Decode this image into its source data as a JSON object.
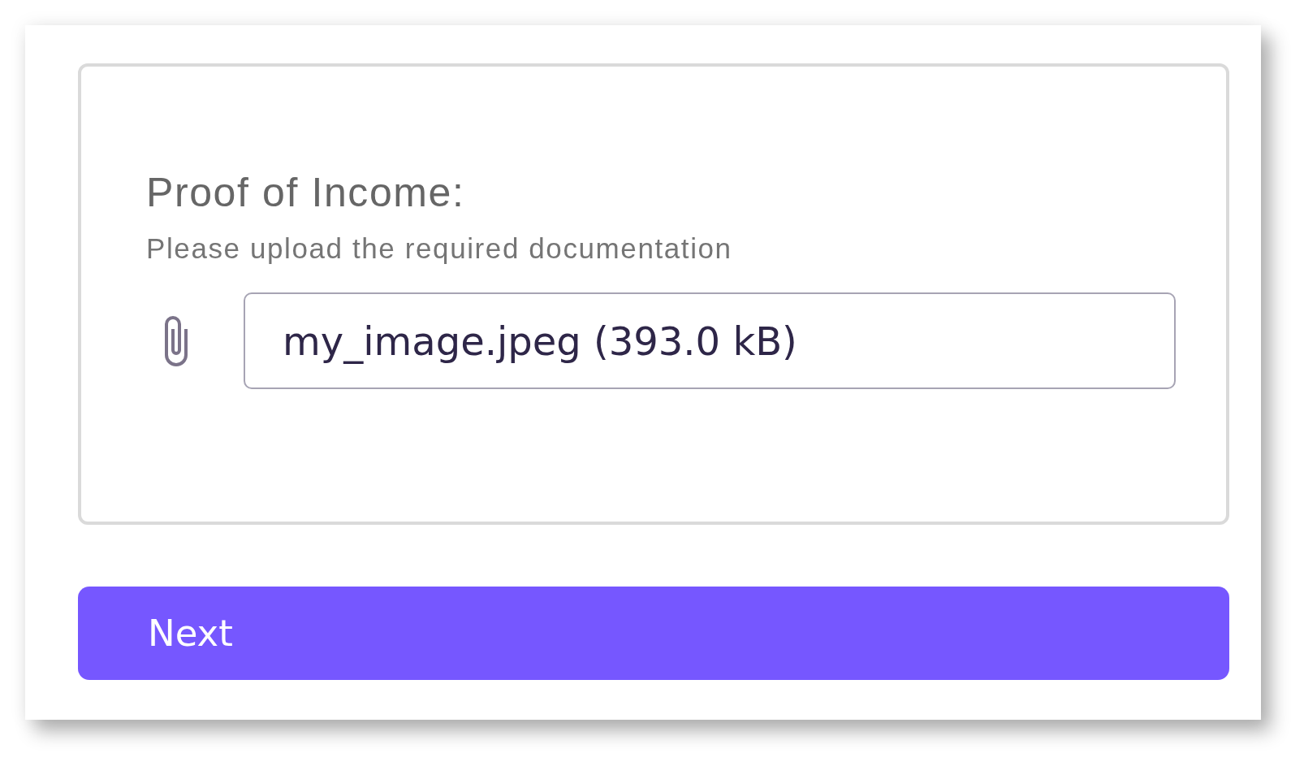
{
  "form": {
    "title": "Proof of Income:",
    "instruction": "Please upload the required documentation",
    "attachment": {
      "value": "my_image.jpeg (393.0 kB)"
    }
  },
  "buttons": [
    {
      "label": "Next",
      "kind": "primary"
    }
  ]
}
